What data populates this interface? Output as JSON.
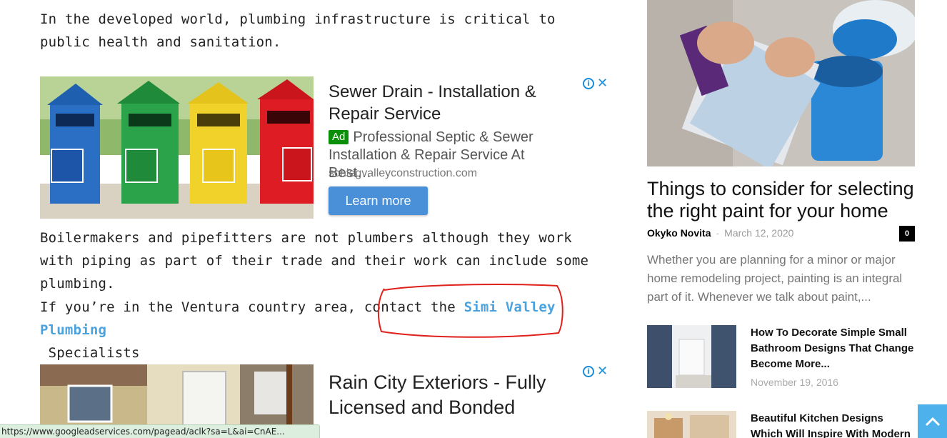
{
  "article": {
    "para1": "In the developed world, plumbing infrastructure is critical to public health and sanitation.",
    "para2": "Boilermakers and pipefitters are not plumbers although they work with piping as part of their trade and their work can include some plumbing.",
    "para3_before": "If you’re in the Ventura country area, contact the ",
    "para3_link": "Simi Valley Plumbing",
    "para3_after": "Specialists"
  },
  "ad1": {
    "title": "Sewer Drain - Installation & Repair Service",
    "badge": "Ad",
    "description": "Professional Septic & Sewer Installation & Repair Service At Best…",
    "url": "schlegvalleyconstruction.com",
    "button": "Learn more"
  },
  "ad2": {
    "title": "Rain City Exteriors - Fully Licensed and Bonded"
  },
  "sidebar": {
    "featured": {
      "title": "Things to consider for selecting the right paint for your home",
      "author": "Okyko Novita",
      "separator": "-",
      "date": "March 12, 2020",
      "comments": "0",
      "excerpt": "Whether you are planning for a minor or major home remodeling project, painting is an integral part of it. Whenever we talk about paint,..."
    },
    "posts": [
      {
        "title": "How To Decorate Simple Small Bathroom Designs That Change Become More...",
        "date": "November 19, 2016"
      },
      {
        "title": "Beautiful Kitchen Designs Which Will Inspire With Modern Ideas",
        "date": ""
      }
    ]
  },
  "statusbar": {
    "url": "https://www.googleadservices.com/pagead/aclk?sa=L&ai=CnAE..."
  },
  "colors": {
    "link": "#4aa3df",
    "ad_button": "#4a90d9",
    "ad_badge": "#0a8f08",
    "scroll_top": "#4db2ec",
    "annotation": "#e0201a"
  }
}
